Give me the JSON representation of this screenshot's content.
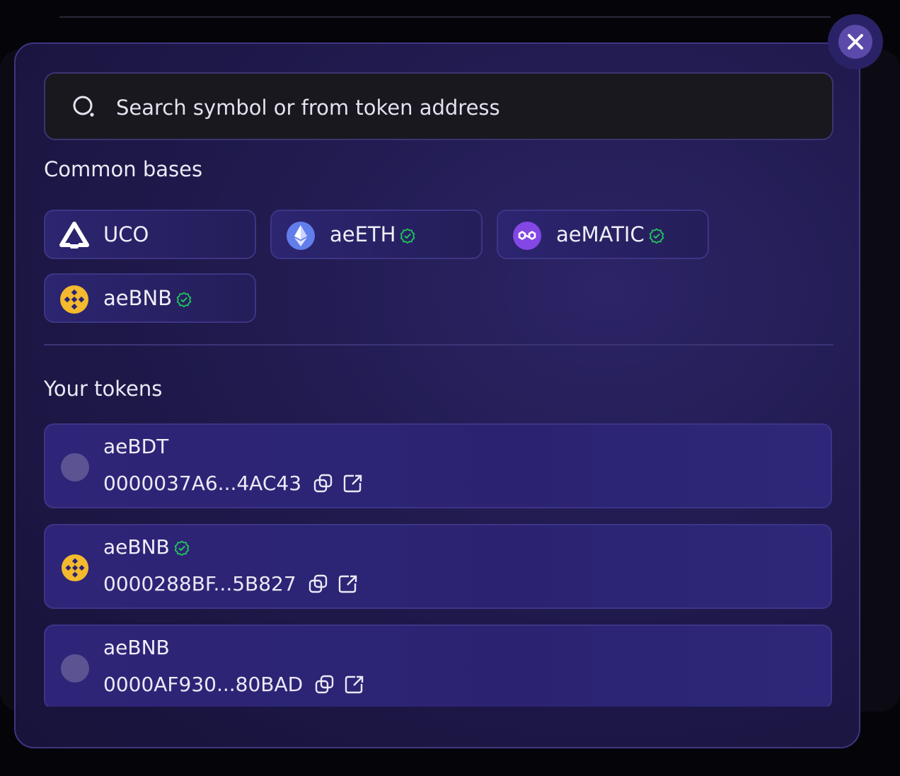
{
  "search": {
    "placeholder": "Search symbol or from token address",
    "icon": "search-icon"
  },
  "sections": {
    "common_bases_title": "Common bases",
    "your_tokens_title": "Your tokens"
  },
  "common_bases": [
    {
      "symbol": "UCO",
      "icon": "uco-logo-icon",
      "verified": false
    },
    {
      "symbol": "aeETH",
      "icon": "ethereum-logo-icon",
      "verified": true
    },
    {
      "symbol": "aeMATIC",
      "icon": "polygon-logo-icon",
      "verified": true
    },
    {
      "symbol": "aeBNB",
      "icon": "bnb-logo-icon",
      "verified": true
    }
  ],
  "tokens": [
    {
      "symbol": "aeBDT",
      "address": "0000037A6...4AC43",
      "icon": "placeholder-token-icon",
      "verified": false
    },
    {
      "symbol": "aeBNB",
      "address": "0000288BF...5B827",
      "icon": "bnb-logo-icon",
      "verified": true
    },
    {
      "symbol": "aeBNB",
      "address": "0000AF930...80BAD",
      "icon": "placeholder-token-icon",
      "verified": false
    }
  ],
  "colors": {
    "accent": "#5b4aa9",
    "verified": "#22c55e",
    "bnb": "#f3ba2f",
    "ethereum": "#627eea",
    "polygon": "#8247e5"
  }
}
